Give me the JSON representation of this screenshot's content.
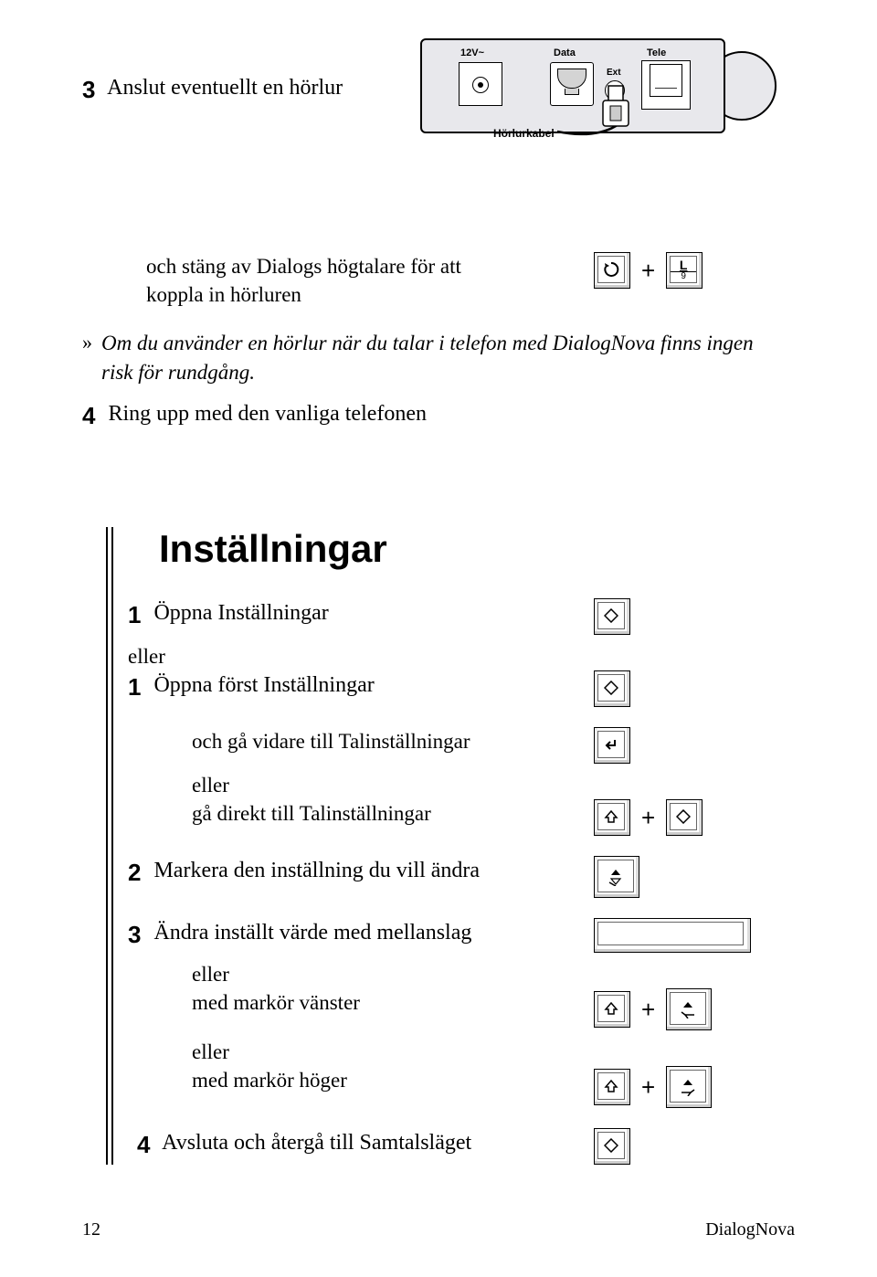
{
  "step3": {
    "num": "3",
    "title": "Anslut eventuellt en hörlur"
  },
  "device": {
    "port1": "12V~",
    "port2": "Data",
    "port3": "Tele",
    "ext": "Ext",
    "cable": "Hörlurkabel"
  },
  "afterdevice": {
    "l1": "och stäng av Dialogs högtalare för att",
    "l2": "koppla in hörluren"
  },
  "keyL": {
    "char": "L",
    "sub": "9"
  },
  "note": {
    "chev": "»",
    "text": "Om du använder en hörlur när du talar i telefon med DialogNova finns ingen risk för rundgång."
  },
  "step4": {
    "num": "4",
    "text": "Ring upp med den vanliga telefonen"
  },
  "section": "Inställningar",
  "s1": {
    "num": "1",
    "text": "Öppna Inställningar"
  },
  "or": "eller",
  "s1b": {
    "num": "1",
    "text": "Öppna först Inställningar"
  },
  "s1c": {
    "text": "och gå vidare till Talinställningar"
  },
  "s1d": {
    "text": "gå direkt till Talinställningar"
  },
  "s2": {
    "num": "2",
    "text": "Markera den inställning du vill ändra"
  },
  "s3": {
    "num": "3",
    "text": "Ändra inställt värde med mellanslag"
  },
  "s3b": "med markör vänster",
  "s3c": "med markör höger",
  "s4": {
    "num": "4",
    "text": "Avsluta och återgå till Samtalsläget"
  },
  "footer": {
    "page": "12",
    "product": "DialogNova"
  }
}
